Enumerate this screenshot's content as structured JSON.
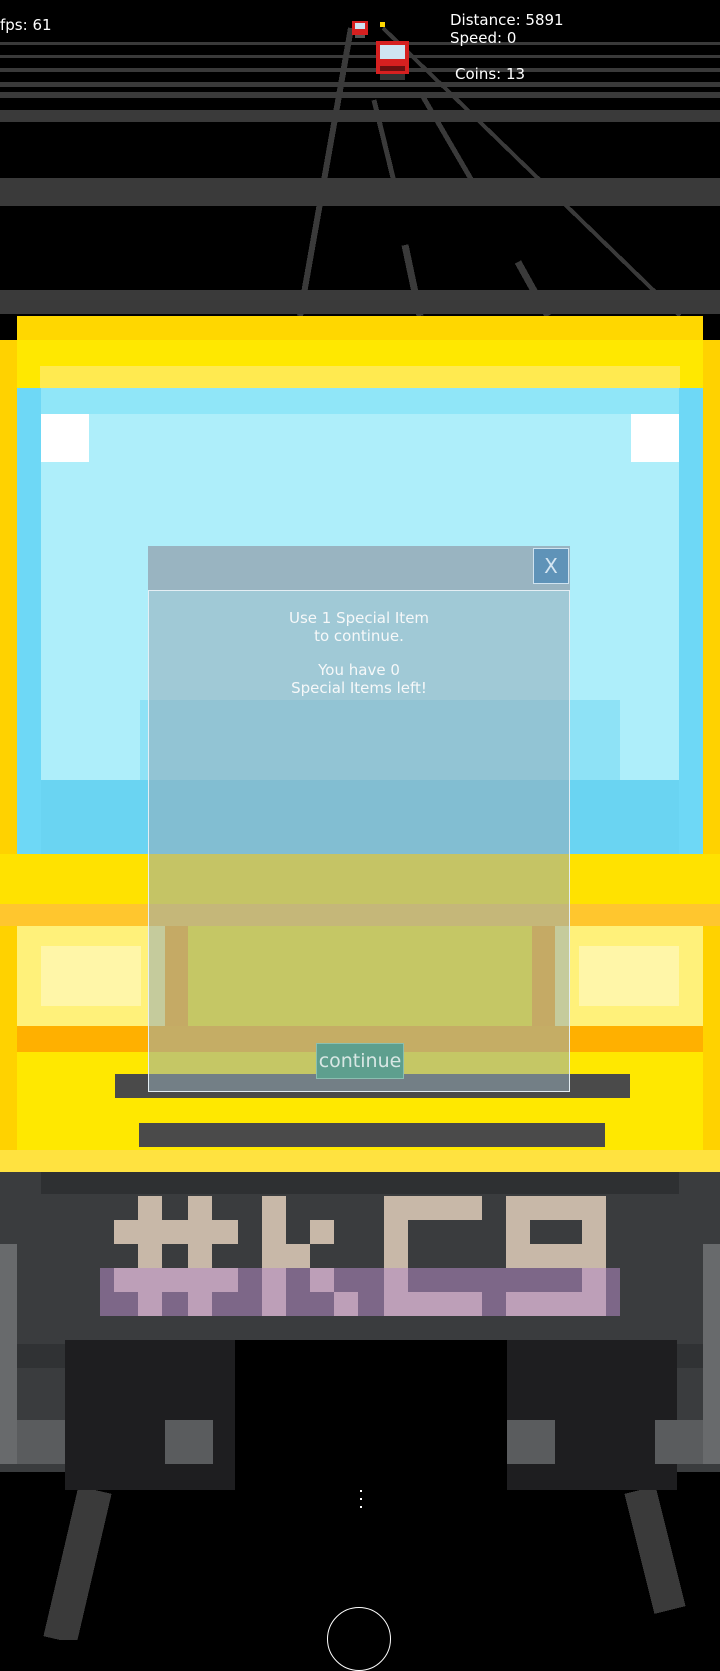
{
  "hud": {
    "fps": "fps: 61",
    "distance": "Distance: 5891",
    "speed": "Speed: 0",
    "coins": "Coins: 13"
  },
  "dialog": {
    "close_label": "X",
    "message_lines": [
      "Use 1 Special Item",
      "to continue.",
      "You have 0",
      "Special Items left!"
    ],
    "continue_label": "continue"
  },
  "bus": {
    "plate_text": "#KC9"
  },
  "colors": {
    "bus_yellow": "#ffe800",
    "windshield": "#aeeefa",
    "road_line": "#3a3a3a",
    "dialog_tint": "#96acb8",
    "continue_button": "#5e9f8e"
  }
}
